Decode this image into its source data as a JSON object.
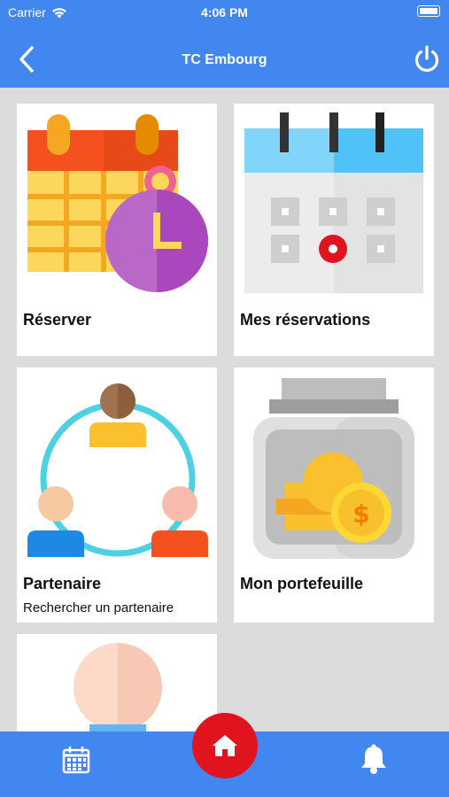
{
  "status_bar": {
    "carrier": "Carrier",
    "time": "4:06 PM"
  },
  "header": {
    "title": "TC Embourg",
    "back_icon": "chevron-left-icon",
    "power_icon": "power-icon"
  },
  "cards": [
    {
      "label": "Réserver",
      "icon": "calendar-clock-icon"
    },
    {
      "label": "Mes réservations",
      "icon": "calendar-icon"
    },
    {
      "label": "Partenaire",
      "sub": "Rechercher un partenaire",
      "icon": "partner-network-icon"
    },
    {
      "label": "Mon portefeuille",
      "icon": "coin-jar-icon"
    },
    {
      "label": "",
      "icon": "profile-avatar-icon"
    }
  ],
  "tab_bar": {
    "left_icon": "calendar-icon",
    "center_icon": "home-icon",
    "right_icon": "bell-icon"
  },
  "colors": {
    "primary": "#4286f0",
    "home_button": "#e0141f",
    "background": "#dcdcdc"
  }
}
